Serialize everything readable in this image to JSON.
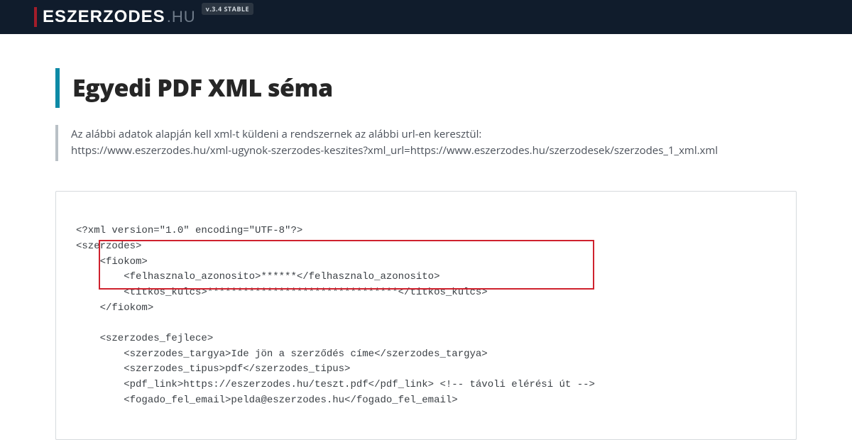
{
  "brand": {
    "main": "ESZERZODES",
    "suffix": ".HU",
    "version": "v.3.4 STABLE"
  },
  "page": {
    "title": "Egyedi PDF XML séma",
    "intro_line1": "Az alábbi adatok alapján kell xml-t küldeni a rendszernek az alábbi url-en keresztül:",
    "intro_line2": "https://www.eszerzodes.hu/xml-ugynok-szerzodes-keszites?xml_url=https://www.eszerzodes.hu/szerzodesek/szerzodes_1_xml.xml"
  },
  "code": {
    "l1": "<?xml version=\"1.0\" encoding=\"UTF-8\"?>",
    "l2": "<szerzodes>",
    "l3": "    <fiokom>",
    "l4": "        <felhasznalo_azonosito>******</felhasznalo_azonosito>",
    "l5": "        <titkos_kulcs>********************************</titkos_kulcs>",
    "l6": "    </fiokom>",
    "l7": "",
    "l8": "    <szerzodes_fejlece>",
    "l9": "        <szerzodes_targya>Ide jön a szerződés címe</szerzodes_targya>",
    "l10": "        <szerzodes_tipus>pdf</szerzodes_tipus>",
    "l11": "        <pdf_link>https://eszerzodes.hu/teszt.pdf</pdf_link> <!-- távoli elérési út -->",
    "l12": "        <fogado_fel_email>pelda@eszerzodes.hu</fogado_fel_email>"
  }
}
